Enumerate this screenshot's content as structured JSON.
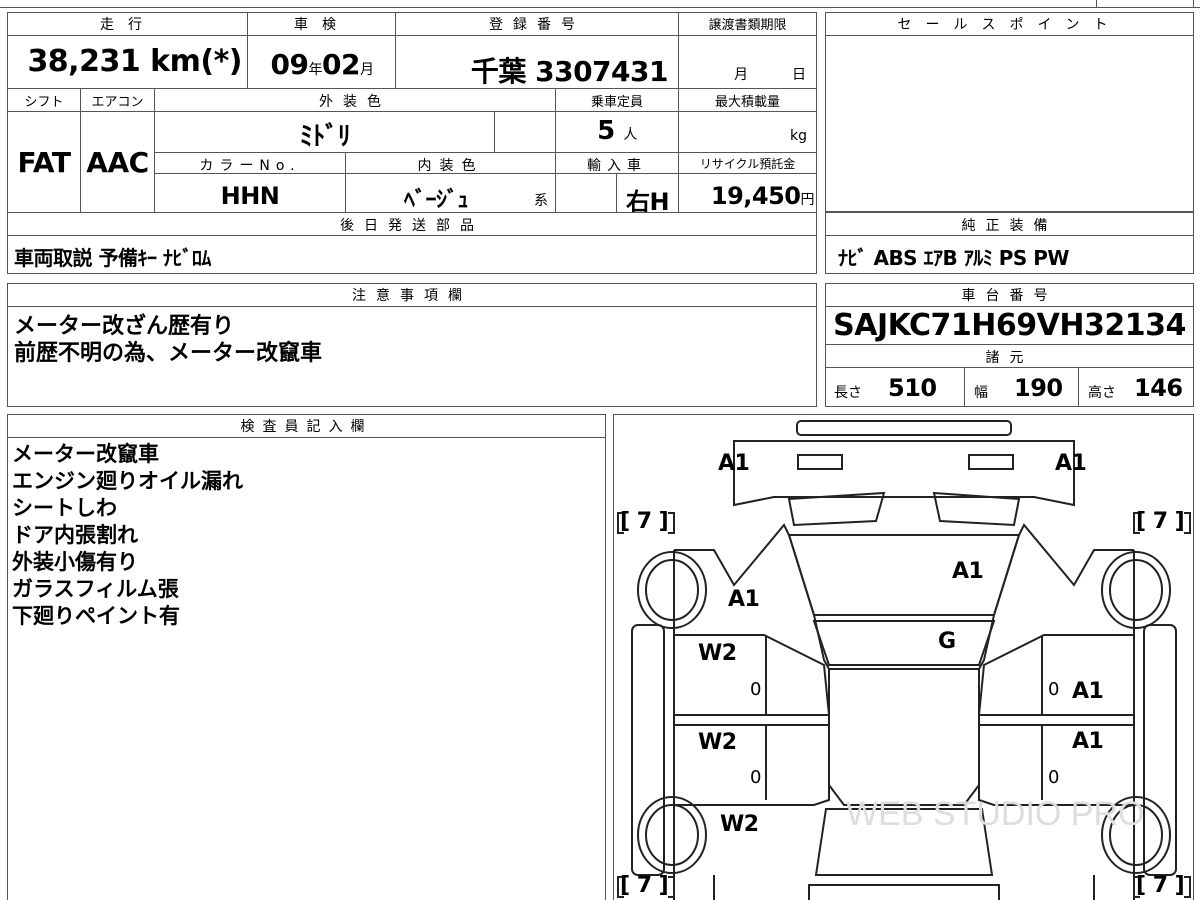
{
  "form": {
    "mileage_label": "走行",
    "mileage_value": "38,231",
    "mileage_unit": "km(*)",
    "inspection_label": "車検",
    "inspection_year": "09",
    "inspection_year_unit": "年",
    "inspection_month": "02",
    "inspection_month_unit": "月",
    "registration_label": "登録番号",
    "registration_value": "千葉 3307431",
    "transfer_label": "譲渡書類期限",
    "transfer_month": "月",
    "transfer_day": "日",
    "shift_label": "シフト",
    "shift_value": "FAT",
    "aircon_label": "エアコン",
    "aircon_value": "AAC",
    "exterior_label": "外装色",
    "exterior_value": "ﾐﾄﾞﾘ",
    "capacity_label": "乗車定員",
    "capacity_value": "5",
    "capacity_unit": "人",
    "maxload_label": "最大積載量",
    "maxload_unit": "kg",
    "colorno_label": "カラーNo.",
    "colorno_value": "HHN",
    "interior_label": "内装色",
    "interior_value": "ﾍﾞｰｼﾞｭ",
    "interior_suffix": "系",
    "import_label": "輸入車",
    "import_value": "右H",
    "recycle_label": "リサイクル預託金",
    "recycle_value": "19,450",
    "recycle_unit": "円",
    "sales_label": "セールスポイント",
    "later_parts_label": "後日発送部品",
    "later_parts_value": "車両取説 予備ｷｰ ﾅﾋﾞﾛﾑ",
    "equipment_label": "純正装備",
    "equipment_value": "ﾅﾋﾞ ABS ｴｱB ｱﾙﾐ PS PW",
    "caution_label": "注意事項欄",
    "caution_lines": [
      "メーター改ざん歴有り",
      "前歴不明の為、メーター改竄車"
    ],
    "chassis_label": "車台番号",
    "chassis_value": "SAJKC71H69VH32134",
    "specs_label": "諸元",
    "length_label": "長さ",
    "length_value": "510",
    "width_label": "幅",
    "width_value": "190",
    "height_label": "高さ",
    "height_value": "146",
    "inspector_label": "検査員記入欄",
    "inspector_lines": [
      "メーター改竄車",
      "エンジン廻りオイル漏れ",
      "シートしわ",
      "ドア内張割れ",
      "外装小傷有り",
      "ガラスフィルム張",
      "下廻りペイント有"
    ]
  },
  "diagram": {
    "marks": {
      "front_left": "A1",
      "front_right": "A1",
      "hood": "A1",
      "left_fender": "A1",
      "windshield": "G",
      "left_front_door": "W2",
      "left_rear_door": "W2",
      "left_rear": "W2",
      "right_front_door": "A1",
      "right_rear_door": "A1",
      "tire_fl": "[ 7 ]",
      "tire_fr": "[ 7 ]",
      "tire_rl": "[ 7 ]",
      "tire_rr": "[ 7 ]",
      "zero1": "0",
      "zero2": "0",
      "zero3": "0",
      "zero4": "0"
    },
    "watermark": "WEB STUDIO PRO"
  }
}
